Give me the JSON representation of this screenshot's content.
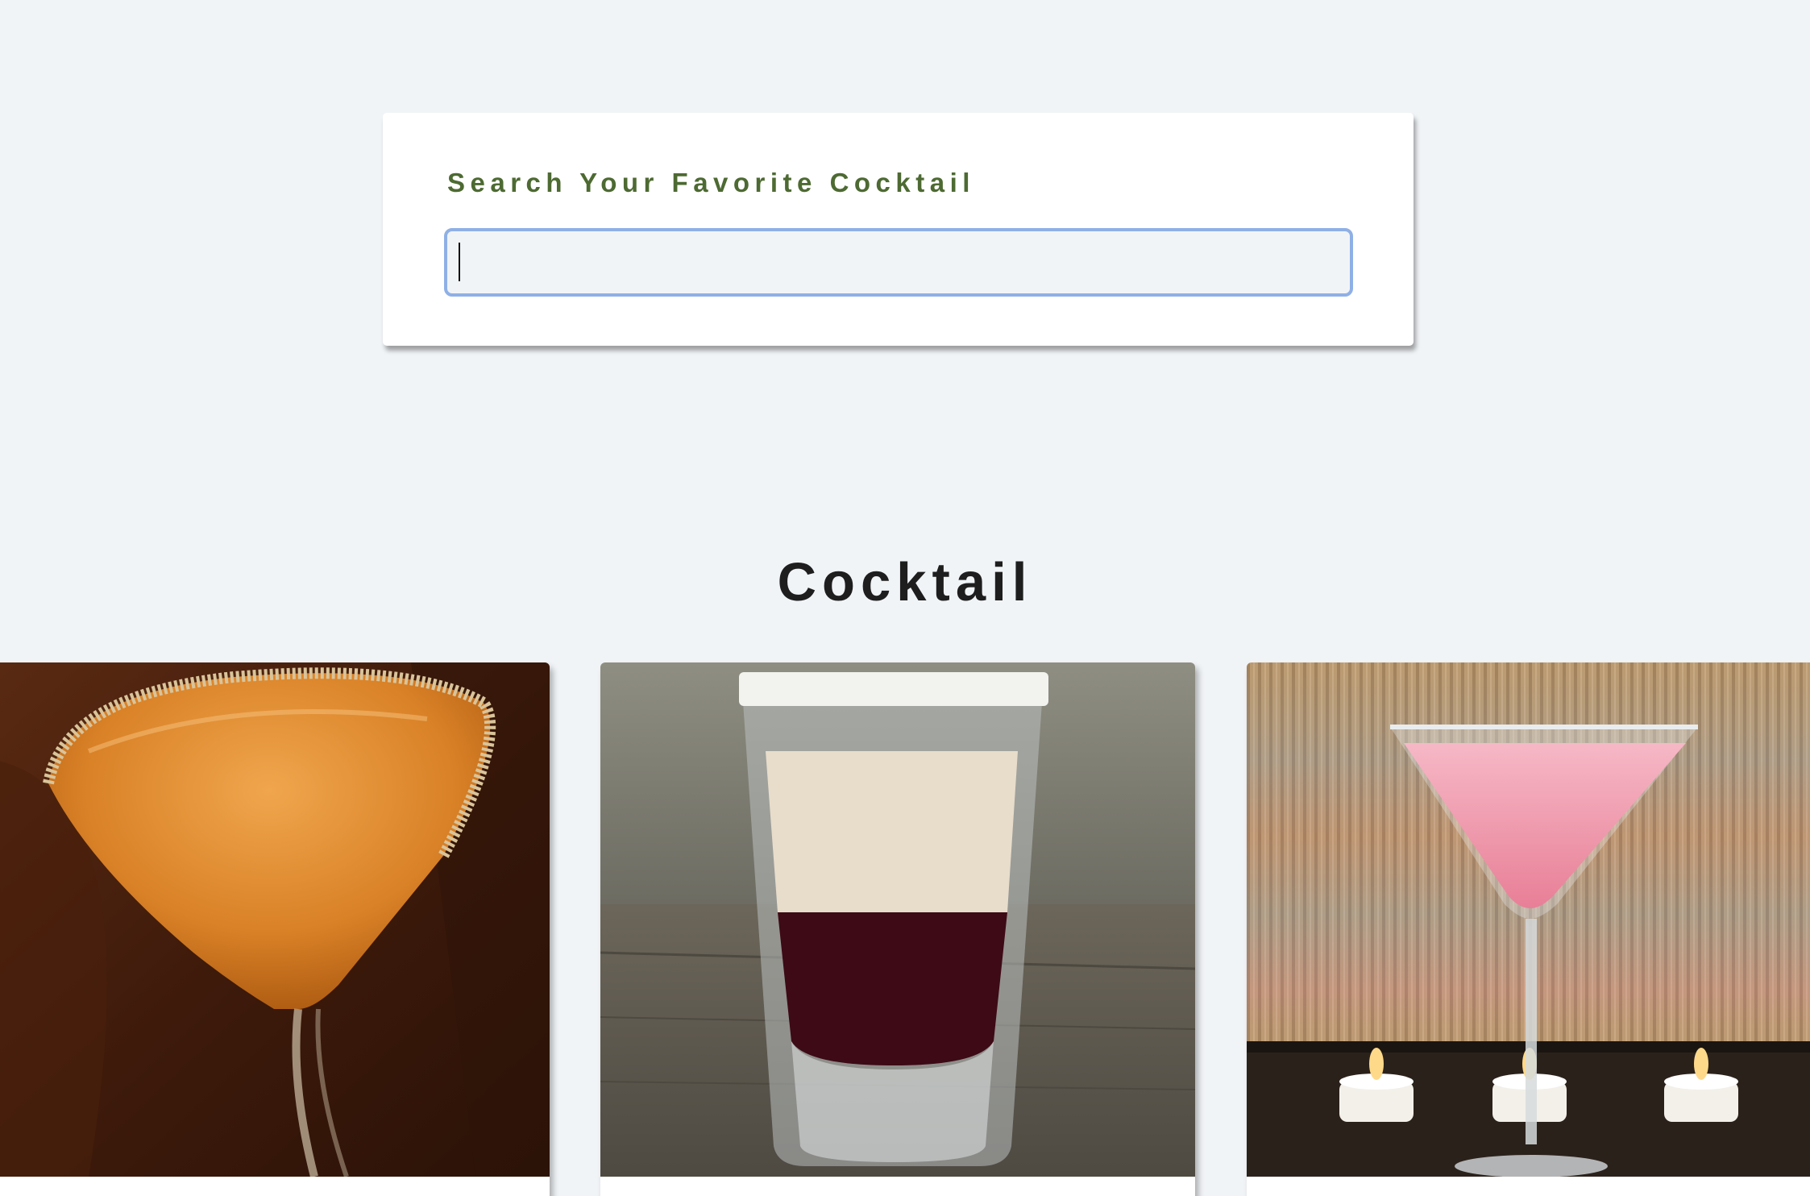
{
  "search": {
    "label": "Search Your Favorite Cocktail",
    "value": "",
    "placeholder": ""
  },
  "section": {
    "title": "Cocktail"
  },
  "colors": {
    "background": "#f1f4f7",
    "label_green": "#4d6a32",
    "input_focus_border": "#8fb0e6",
    "title": "#1e1e1e"
  },
  "cocktails": [
    {
      "image_icon": "orange-martini-sugar-rim-image"
    },
    {
      "image_icon": "layered-cream-shot-glass-image"
    },
    {
      "image_icon": "pink-martini-candles-image"
    }
  ]
}
